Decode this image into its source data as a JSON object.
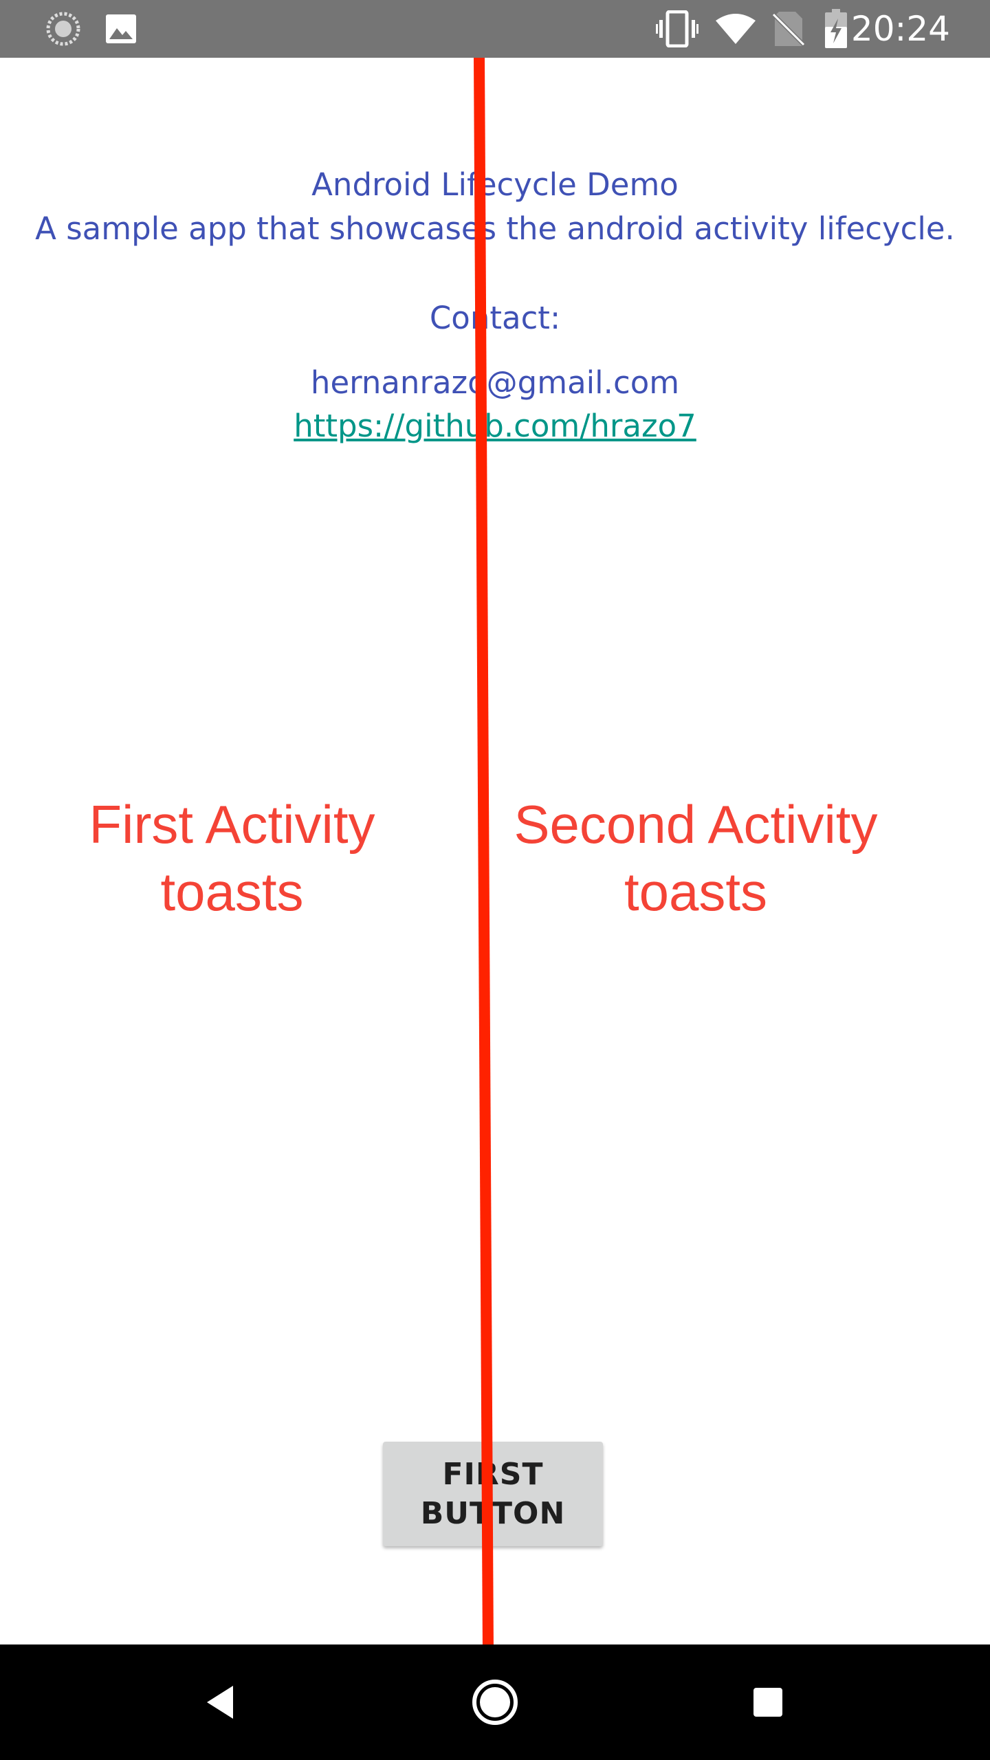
{
  "status_bar": {
    "time": "20:24",
    "icons": [
      "sync-icon",
      "image-notification-icon",
      "vibrate-icon",
      "wifi-icon",
      "no-sim-icon",
      "battery-charging-icon"
    ]
  },
  "app": {
    "title": "Android Lifecycle Demo",
    "subtitle": "A sample app that showcases the android activity lifecycle.",
    "contact_label": "Contact:",
    "email": "hernanrazo@gmail.com",
    "github_link": "https://github.com/hrazo7"
  },
  "annotations": {
    "first_activity_line1": "First Activity",
    "first_activity_line2": "toasts",
    "second_activity_line1": "Second Activity",
    "second_activity_line2": "toasts"
  },
  "button": {
    "label_line1": "FIRST",
    "label_line2": "BUTTON"
  },
  "nav_bar": {
    "buttons": [
      "back-icon",
      "home-icon",
      "recents-icon"
    ]
  },
  "colors": {
    "status_bar": "#757575",
    "text_primary": "#3f51b5",
    "link": "#009688",
    "annotation_red": "#f44336",
    "button_bg": "#d6d7d7",
    "nav_bar": "#000000"
  }
}
